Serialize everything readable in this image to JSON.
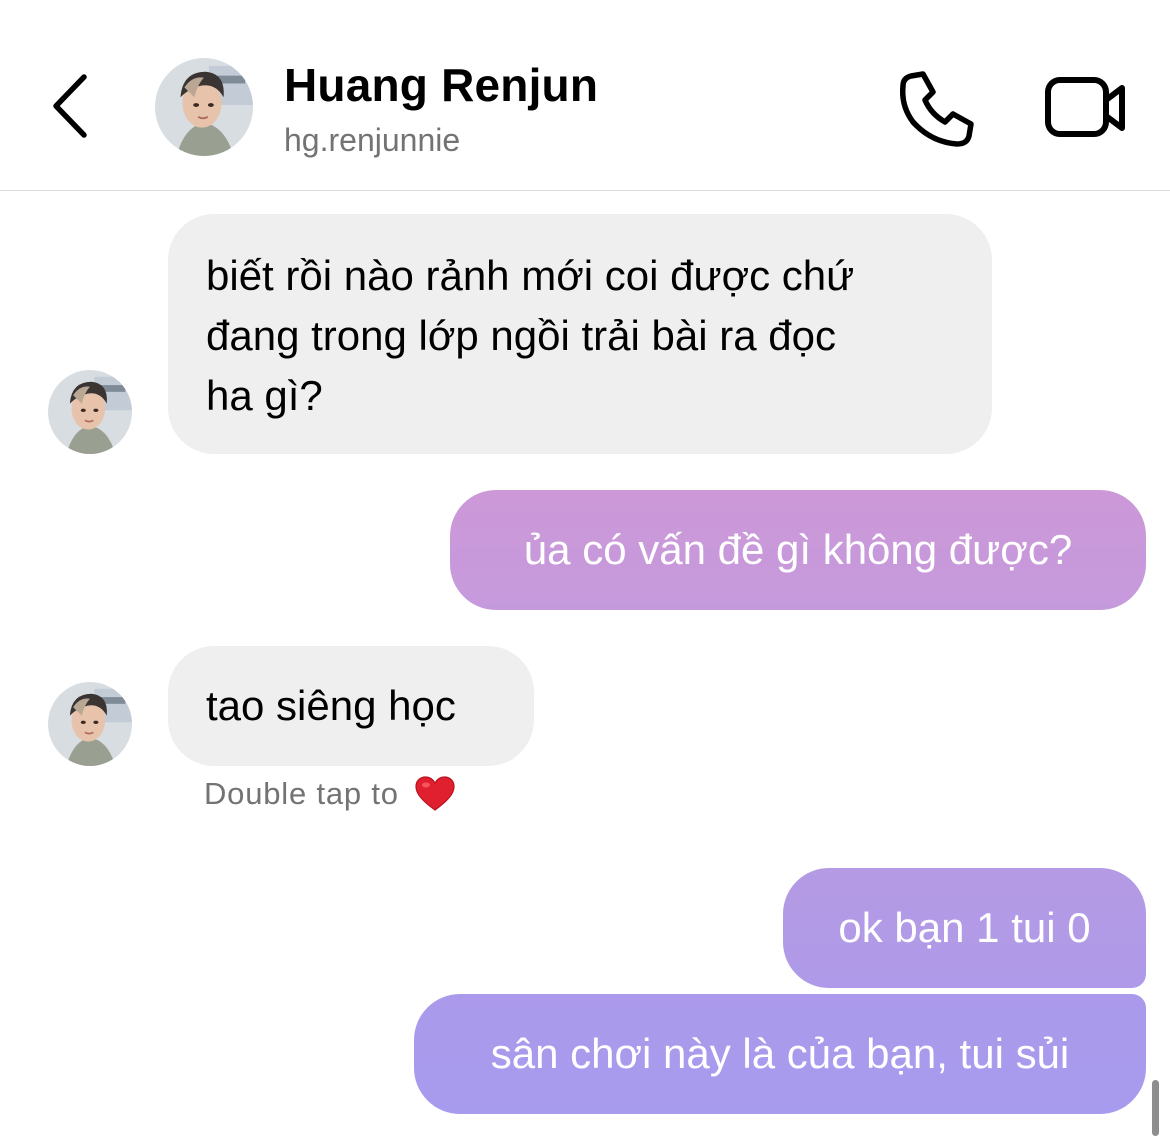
{
  "header": {
    "contact_name": "Huang Renjun",
    "contact_handle": "hg.renjunnie",
    "back_icon": "chevron-left-icon",
    "call_icon": "phone-icon",
    "video_icon": "video-camera-icon"
  },
  "messages": [
    {
      "direction": "incoming",
      "lines": [
        "biết rồi nào rảnh mới coi được chứ",
        "đang trong lớp ngồi trải bài ra đọc",
        "ha gì?"
      ]
    },
    {
      "direction": "outgoing",
      "text": "ủa có vấn đề gì không được?"
    },
    {
      "direction": "incoming",
      "text": "tao siêng học"
    },
    {
      "direction": "outgoing",
      "text": "ok bạn 1 tui 0"
    },
    {
      "direction": "outgoing",
      "text": "sân chơi này là của bạn, tui sủi"
    }
  ],
  "hint": {
    "text": "Double tap to",
    "icon": "heart-icon"
  },
  "colors": {
    "incoming_bubble": "#efefef",
    "outgoing_gradient": [
      "#c896d8",
      "#ab9aeb"
    ],
    "heart": "#e0202e"
  }
}
